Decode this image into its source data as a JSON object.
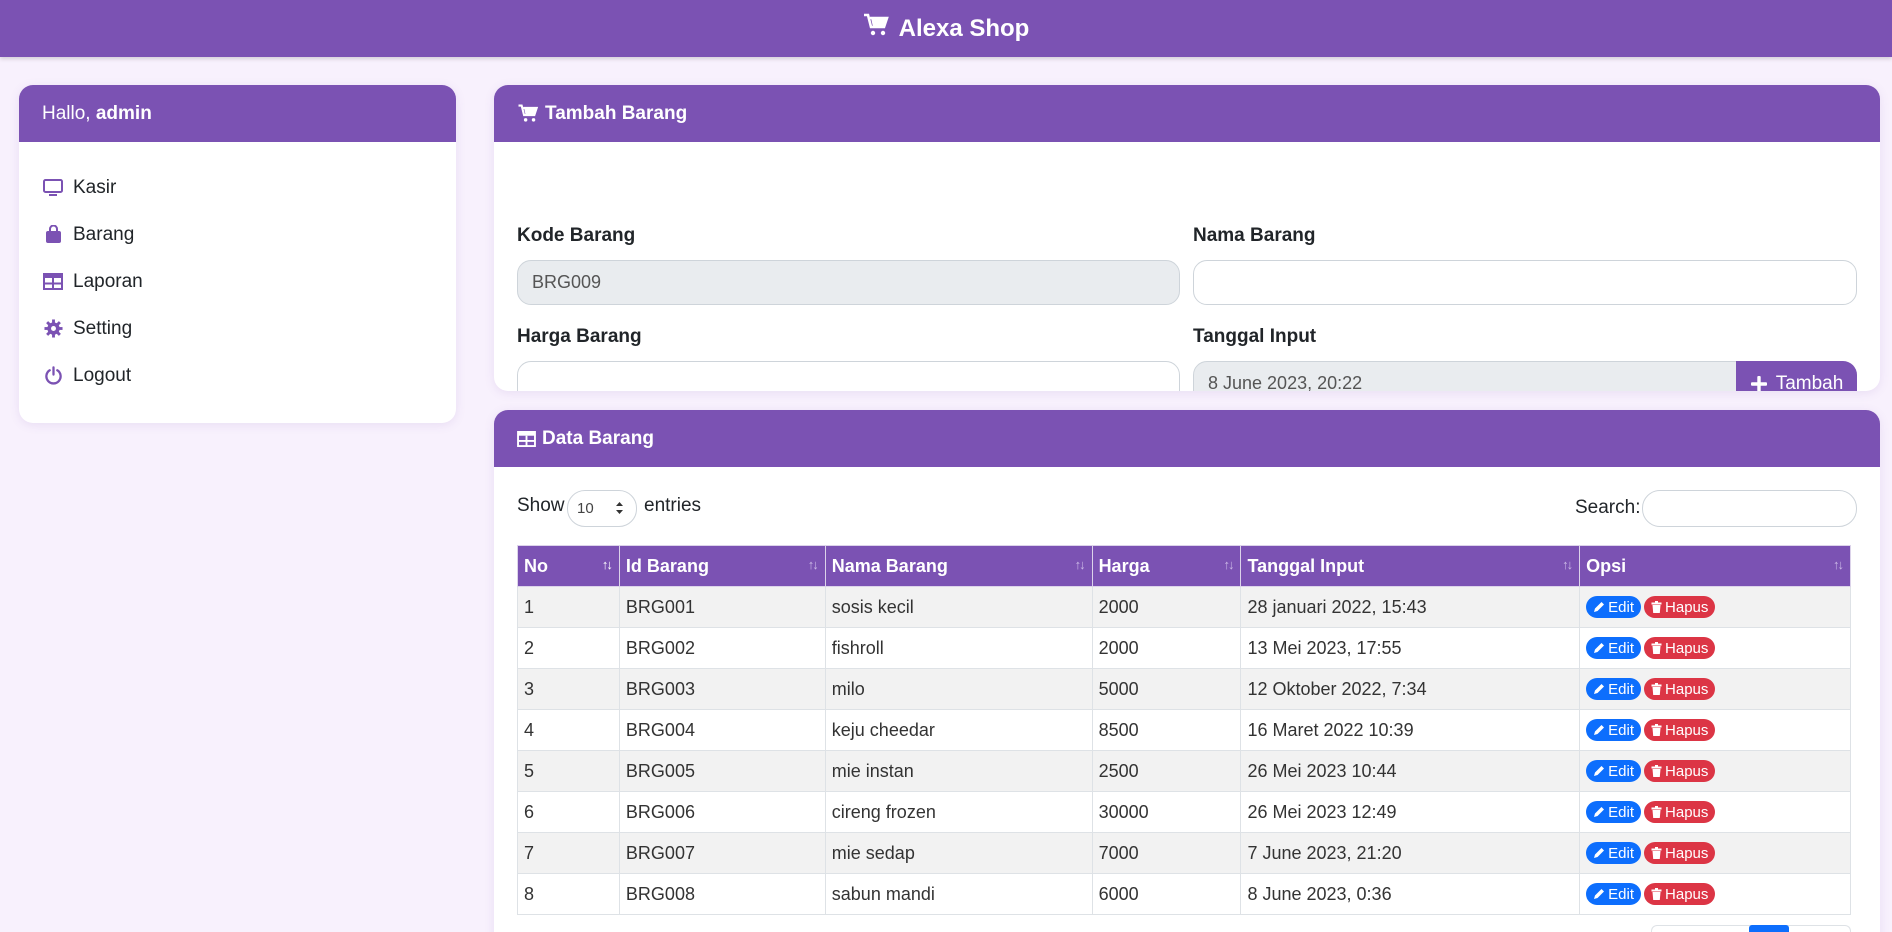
{
  "header": {
    "title": "Alexa Shop"
  },
  "sidebar": {
    "greeting": "Hallo, ",
    "username": "admin",
    "items": [
      {
        "label": "Kasir",
        "icon": "monitor-icon"
      },
      {
        "label": "Barang",
        "icon": "bag-icon"
      },
      {
        "label": "Laporan",
        "icon": "table-icon"
      },
      {
        "label": "Setting",
        "icon": "gear-icon"
      },
      {
        "label": "Logout",
        "icon": "power-icon"
      }
    ]
  },
  "tambah": {
    "title": "Tambah Barang",
    "kode_label": "Kode Barang",
    "kode_value": "BRG009",
    "nama_label": "Nama Barang",
    "nama_value": "",
    "harga_label": "Harga Barang",
    "harga_value": "",
    "tanggal_label": "Tanggal Input",
    "tanggal_value": "8 June 2023, 20:22",
    "button_label": "Tambah"
  },
  "data": {
    "title": "Data Barang",
    "show_label": "Show",
    "entries_value": "10",
    "entries_label": "entries",
    "search_label": "Search:",
    "columns": [
      "No",
      "Id Barang",
      "Nama Barang",
      "Harga",
      "Tanggal Input",
      "Opsi"
    ],
    "edit_label": "Edit",
    "hapus_label": "Hapus",
    "rows": [
      [
        "1",
        "BRG001",
        "sosis kecil",
        "2000",
        "28 januari 2022, 15:43"
      ],
      [
        "2",
        "BRG002",
        "fishroll",
        "2000",
        "13 Mei 2023, 17:55"
      ],
      [
        "3",
        "BRG003",
        "milo",
        "5000",
        "12 Oktober 2022, 7:34"
      ],
      [
        "4",
        "BRG004",
        "keju cheedar",
        "8500",
        "16 Maret 2022 10:39"
      ],
      [
        "5",
        "BRG005",
        "mie instan",
        "2500",
        "26 Mei 2023 10:44"
      ],
      [
        "6",
        "BRG006",
        "cireng frozen",
        "30000",
        "26 Mei 2023 12:49"
      ],
      [
        "7",
        "BRG007",
        "mie sedap",
        "7000",
        "7 June 2023, 21:20"
      ],
      [
        "8",
        "BRG008",
        "sabun mandi",
        "6000",
        "8 June 2023, 0:36"
      ]
    ]
  },
  "colors": {
    "primary": "#7b52b3",
    "background": "#f8f1fd",
    "edit": "#0d6efd",
    "hapus": "#dc3545"
  }
}
